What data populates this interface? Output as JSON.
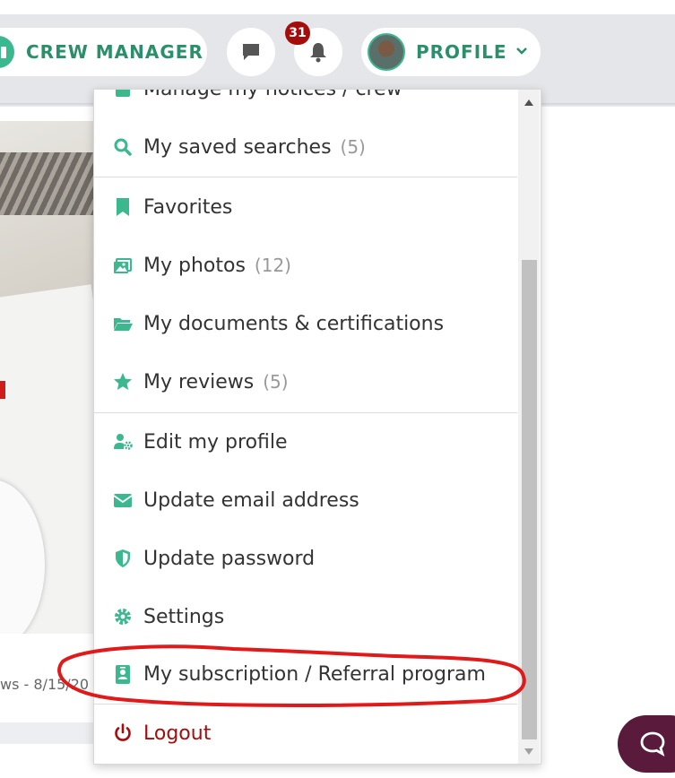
{
  "header": {
    "crew_label": "CREW MANAGER",
    "notification_count": "31",
    "profile_label": "PROFILE"
  },
  "background": {
    "caption": "ws - 8/15/20"
  },
  "menu": {
    "items": [
      {
        "label": "Manage my notices / crew",
        "icon": "notice-icon"
      },
      {
        "label": "My saved searches",
        "count": "(5)",
        "icon": "search-icon"
      },
      {
        "label": "Favorites",
        "icon": "bookmark-icon"
      },
      {
        "label": "My photos",
        "count": "(12)",
        "icon": "photos-icon"
      },
      {
        "label": "My documents & certifications",
        "icon": "folder-icon"
      },
      {
        "label": "My reviews",
        "count": "(5)",
        "icon": "star-icon"
      },
      {
        "label": "Edit my profile",
        "icon": "user-cog-icon"
      },
      {
        "label": "Update email address",
        "icon": "envelope-icon"
      },
      {
        "label": "Update password",
        "icon": "shield-icon"
      },
      {
        "label": "Settings",
        "icon": "gear-icon"
      },
      {
        "label": "My subscription / Referral program",
        "icon": "id-badge-icon"
      },
      {
        "label": "Logout",
        "icon": "power-icon"
      }
    ]
  },
  "colors": {
    "accent": "#3cb88f",
    "accent_text": "#2a8f6a",
    "logout": "#a50d0d",
    "badge": "#a50d0d",
    "highlight_annotation": "#e01a1a",
    "chat_bubble": "#5a1a3c"
  }
}
